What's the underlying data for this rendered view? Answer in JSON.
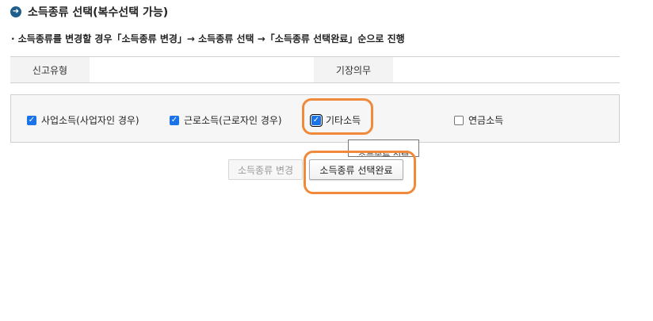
{
  "section": {
    "title": "소득종류 선택(복수선택 가능)",
    "icon": "arrow-right-circle-icon"
  },
  "instruction": "· 소득종류를 변경할 경우「소득종류 변경」→ 소득종류 선택 →「소득종류 선택완료」순으로 진행",
  "info_table": {
    "filing_type_label": "신고유형",
    "filing_type_value": "",
    "bookkeeping_label": "기장의무",
    "bookkeeping_value": ""
  },
  "income_types": [
    {
      "label": "사업소득(사업자인 경우)",
      "checked": true
    },
    {
      "label": "근로소득(근로자인 경우)",
      "checked": true
    },
    {
      "label": "기타소득",
      "checked": true
    },
    {
      "label": "연금소득",
      "checked": false
    }
  ],
  "tooltip": "소득종류 선택",
  "buttons": {
    "change_label": "소득종류 변경",
    "complete_label": "소득종류 선택완료"
  },
  "colors": {
    "highlight": "#f0893a",
    "checkbox_checked": "#1a73e8",
    "title_icon": "#1f5e8c"
  }
}
